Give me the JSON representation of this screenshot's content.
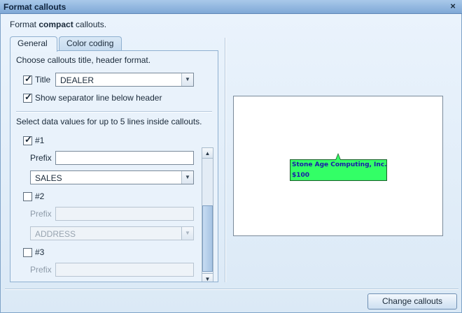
{
  "window": {
    "title": "Format callouts",
    "close_glyph": "×"
  },
  "header": {
    "prefix": "Format ",
    "emphasis": "compact",
    "suffix": " callouts."
  },
  "tabs": [
    {
      "label": "General",
      "active": true
    },
    {
      "label": "Color coding",
      "active": false
    }
  ],
  "general": {
    "section1_label": "Choose callouts title, header format.",
    "title_checkbox": {
      "label": "Title",
      "checked": true
    },
    "title_select": {
      "value": "DEALER"
    },
    "separator_checkbox": {
      "label": "Show separator line below header",
      "checked": true
    },
    "section2_label": "Select data values for up to 5 lines inside callouts.",
    "lines": [
      {
        "label": "#1",
        "checked": true,
        "prefix_label": "Prefix",
        "prefix_value": "",
        "select_value": "SALES"
      },
      {
        "label": "#2",
        "checked": false,
        "prefix_label": "Prefix",
        "prefix_value": "",
        "select_value": "ADDRESS"
      },
      {
        "label": "#3",
        "checked": false,
        "prefix_label": "Prefix",
        "prefix_value": ""
      }
    ]
  },
  "preview": {
    "callout_line1": "Stone Age Computing, Inc.",
    "callout_line2": "$100",
    "callout_color": "#33ff66",
    "text_color": "#1a1aa8"
  },
  "footer": {
    "button_label": "Change callouts"
  },
  "icons": {
    "check": "✓",
    "dropdown": "▼",
    "scroll_up": "▲",
    "scroll_down": "▼"
  }
}
